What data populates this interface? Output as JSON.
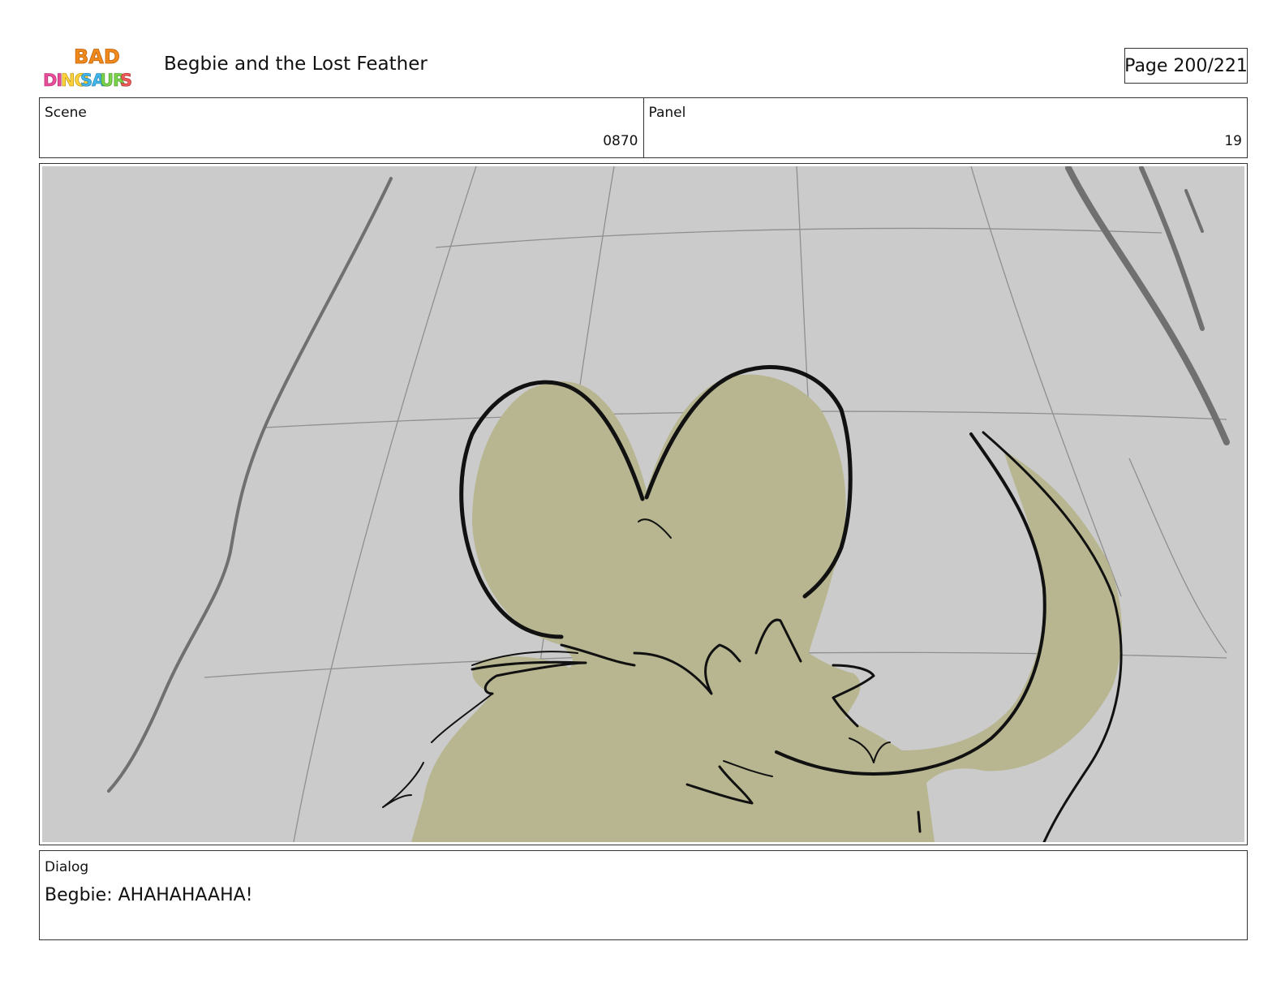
{
  "header": {
    "logo_text_line1": "BAD",
    "logo_text_line2": "DINOSAURS",
    "title": "Begbie and the Lost Feather",
    "page_label": "Page 200/221"
  },
  "info": {
    "scene_label": "Scene",
    "scene_value": "0870",
    "panel_label": "Panel",
    "panel_value": "19"
  },
  "panel_image": {
    "colors": {
      "background": "#cbcbcb",
      "grid_lines": "#8f8f8f",
      "creature_fill": "#b8b690",
      "ink": "#111111",
      "dark_strokes": "#707070"
    }
  },
  "dialog": {
    "label": "Dialog",
    "text": "Begbie: AHAHAHAAHA!"
  }
}
